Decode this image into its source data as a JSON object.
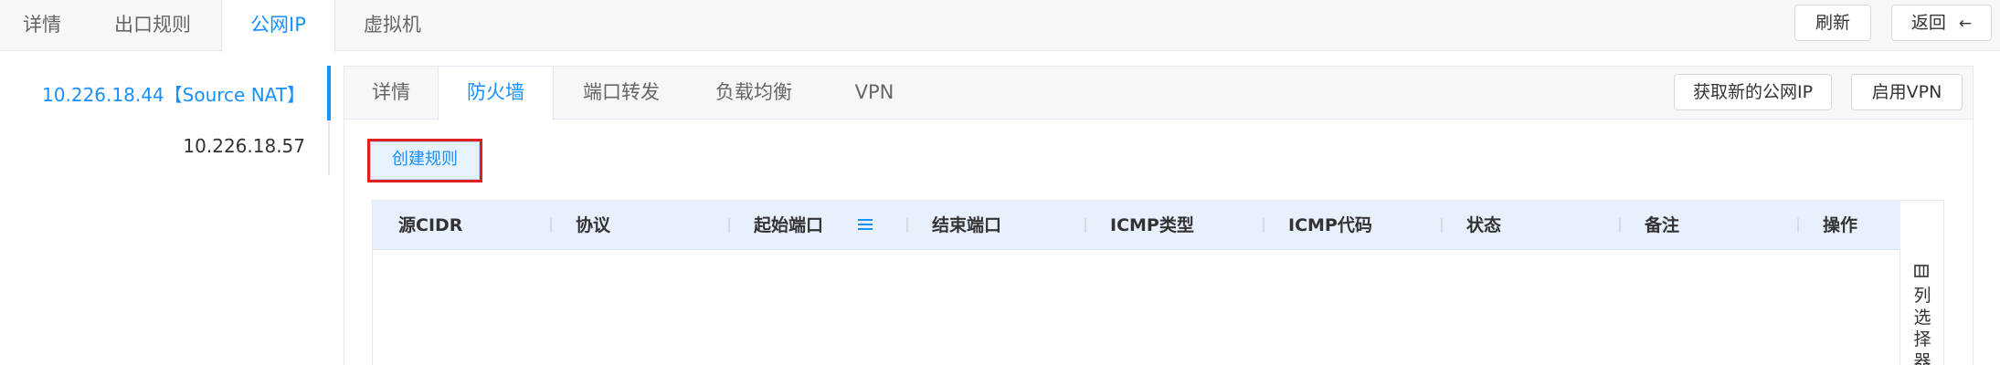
{
  "top_tabs": [
    {
      "label": "详情"
    },
    {
      "label": "出口规则"
    },
    {
      "label": "公网IP"
    },
    {
      "label": "虚拟机"
    }
  ],
  "top_active_tab": 2,
  "top_actions": {
    "refresh_label": "刷新",
    "back_label": "返回"
  },
  "ip_list": [
    {
      "label": "10.226.18.44【Source NAT】"
    },
    {
      "label": "10.226.18.57"
    }
  ],
  "inner_tabs": [
    {
      "label": "详情"
    },
    {
      "label": "防火墙"
    },
    {
      "label": "端口转发"
    },
    {
      "label": "负载均衡"
    },
    {
      "label": "VPN"
    }
  ],
  "inner_active_tab": 1,
  "inner_actions": {
    "get_new_ip_label": "获取新的公网IP",
    "enable_vpn_label": "启用VPN"
  },
  "create_rule_label": "创建规则",
  "table": {
    "columns": [
      "源CIDR",
      "协议",
      "起始端口",
      "结束端口",
      "ICMP类型",
      "ICMP代码",
      "状态",
      "备注",
      "操作"
    ]
  },
  "column_selector_label": "列选择器",
  "colors": {
    "accent": "#1890ff",
    "highlight_border": "#e02020",
    "header_bg": "#e8effd"
  }
}
